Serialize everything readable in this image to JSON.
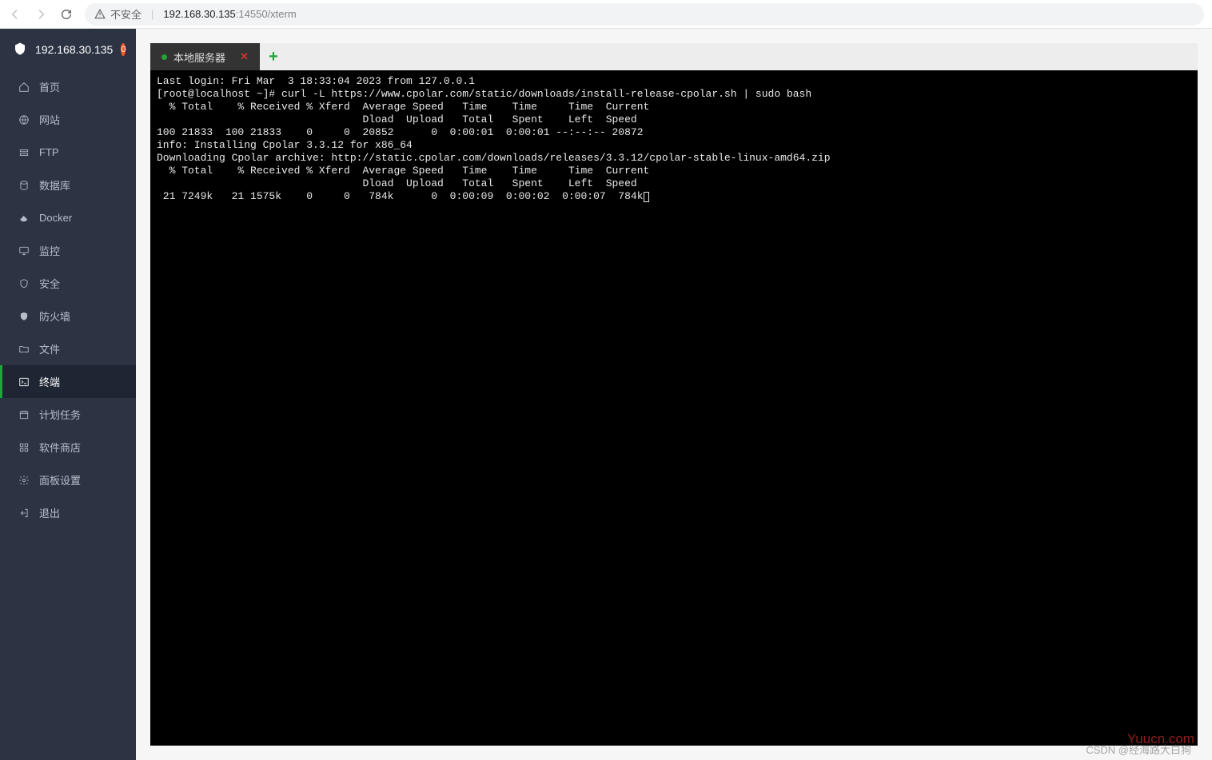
{
  "browser": {
    "insecure_label": "不安全",
    "url_host": "192.168.30.135",
    "url_port": ":14550",
    "url_path": "/xterm"
  },
  "sidebar": {
    "host": "192.168.30.135",
    "badge": "0",
    "items": [
      {
        "label": "首页",
        "icon": "home"
      },
      {
        "label": "网站",
        "icon": "globe"
      },
      {
        "label": "FTP",
        "icon": "ftp"
      },
      {
        "label": "数据库",
        "icon": "db"
      },
      {
        "label": "Docker",
        "icon": "docker"
      },
      {
        "label": "监控",
        "icon": "monitor"
      },
      {
        "label": "安全",
        "icon": "shield"
      },
      {
        "label": "防火墙",
        "icon": "firewall"
      },
      {
        "label": "文件",
        "icon": "folder"
      },
      {
        "label": "终端",
        "icon": "terminal"
      },
      {
        "label": "计划任务",
        "icon": "schedule"
      },
      {
        "label": "软件商店",
        "icon": "apps"
      },
      {
        "label": "面板设置",
        "icon": "gear"
      },
      {
        "label": "退出",
        "icon": "exit"
      }
    ],
    "active_index": 9
  },
  "tabs": {
    "main": "本地服务器",
    "close": "✕",
    "add": "+"
  },
  "terminal": {
    "lines": [
      "Last login: Fri Mar  3 18:33:04 2023 from 127.0.0.1",
      "[root@localhost ~]# curl -L https://www.cpolar.com/static/downloads/install-release-cpolar.sh | sudo bash",
      "  % Total    % Received % Xferd  Average Speed   Time    Time     Time  Current",
      "                                 Dload  Upload   Total   Spent    Left  Speed",
      "100 21833  100 21833    0     0  20852      0  0:00:01  0:00:01 --:--:-- 20872",
      "info: Installing Cpolar 3.3.12 for x86_64",
      "Downloading Cpolar archive: http://static.cpolar.com/downloads/releases/3.3.12/cpolar-stable-linux-amd64.zip",
      "  % Total    % Received % Xferd  Average Speed   Time    Time     Time  Current",
      "                                 Dload  Upload   Total   Spent    Left  Speed",
      " 21 7249k   21 1575k    0     0   784k      0  0:00:09  0:00:02  0:00:07  784k"
    ]
  },
  "watermark1": "Yuucn.com",
  "watermark2": "CSDN @经海路大白狗"
}
